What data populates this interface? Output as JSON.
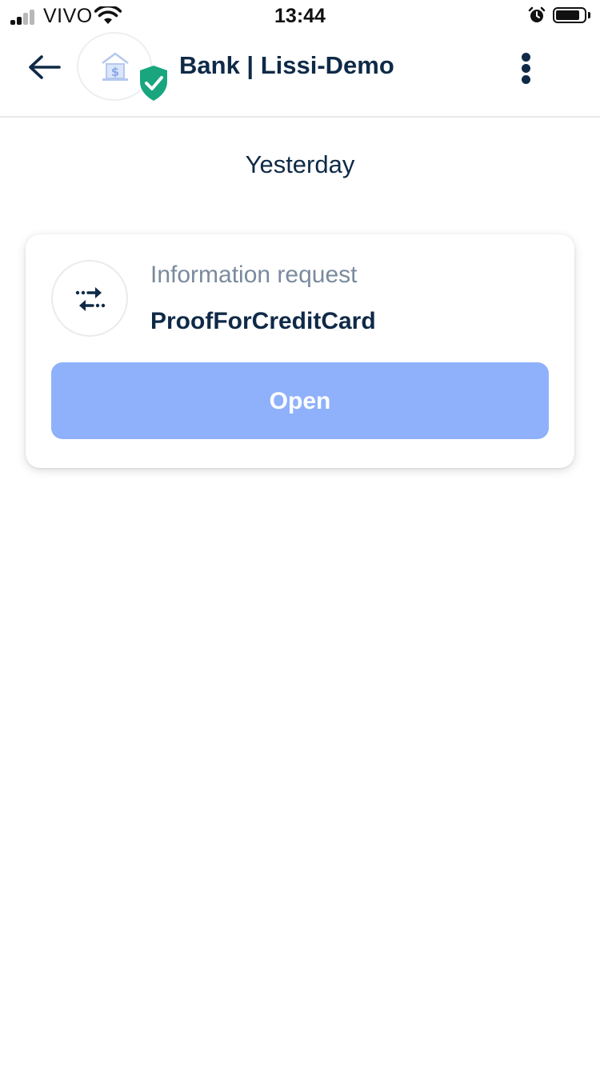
{
  "status_bar": {
    "carrier": "VIVO",
    "time": "13:44",
    "signal_bars": 4,
    "signal_bars_active": 2,
    "battery_level": 0.85,
    "icons": [
      "signal-icon",
      "wifi-icon",
      "alarm-icon",
      "battery-icon"
    ]
  },
  "header": {
    "title": "Bank | Lissi-Demo",
    "back_icon": "arrow-left-icon",
    "avatar_icon": "bank-icon",
    "verified_icon": "shield-check-icon",
    "menu_icon": "more-vertical-icon"
  },
  "date_label": "Yesterday",
  "card": {
    "type": "Information request",
    "title": "ProofForCreditCard",
    "icon": "exchange-arrows-icon",
    "button_label": "Open"
  },
  "colors": {
    "text_primary": "#0f2a47",
    "text_secondary": "#7a8a9e",
    "button": "#8fb1fb",
    "verified": "#19a67f",
    "signal_active": "#111111",
    "signal_inactive": "#b8b8b8"
  }
}
